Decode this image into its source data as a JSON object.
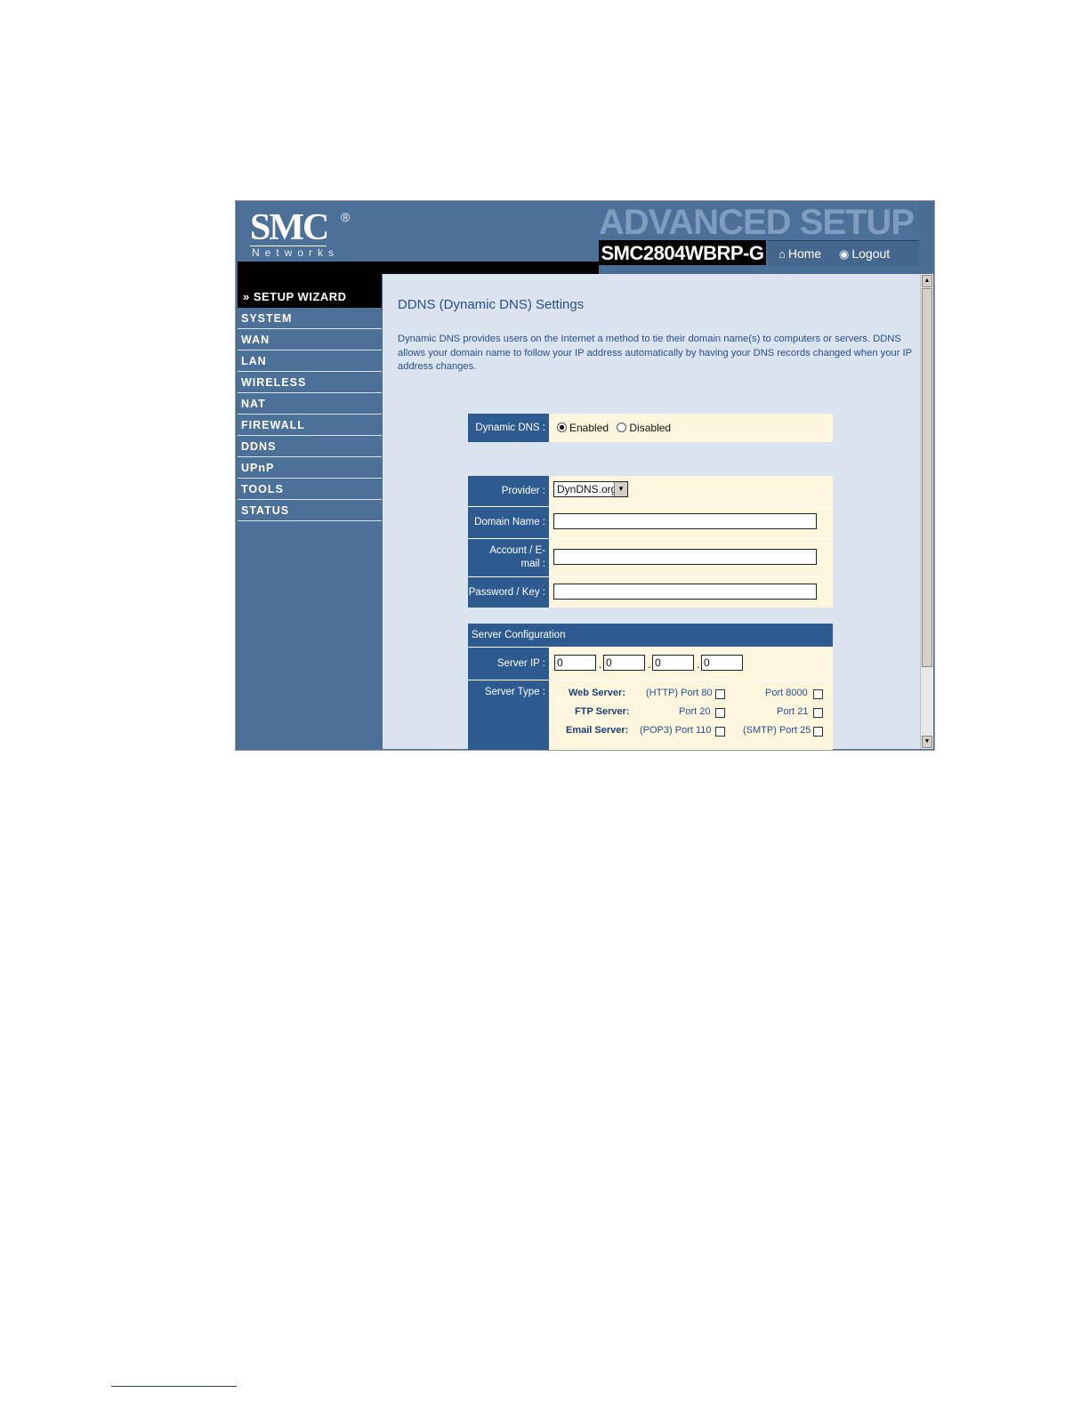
{
  "header": {
    "logo_text": "SMC",
    "logo_reg": "®",
    "logo_sub": "Networks",
    "banner": "ADVANCED SETUP",
    "model": "SMC2804WBRP-G",
    "home_label": "Home",
    "logout_label": "Logout"
  },
  "sidebar": {
    "wizard": "» SETUP WIZARD",
    "items": [
      "SYSTEM",
      "WAN",
      "LAN",
      "WIRELESS",
      "NAT",
      "FIREWALL",
      "DDNS",
      "UPnP",
      "TOOLS",
      "STATUS"
    ]
  },
  "content": {
    "title": "DDNS (Dynamic DNS) Settings",
    "description": "Dynamic DNS provides users on the Internet a method to tie their domain name(s) to computers or servers. DDNS allows your domain name to follow your IP address automatically by having your DNS records changed when your IP address changes."
  },
  "ddns": {
    "label": "Dynamic DNS :",
    "enabled": "Enabled",
    "disabled": "Disabled",
    "selected": "Enabled"
  },
  "form": {
    "provider_label": "Provider :",
    "provider_value": "DynDNS.org",
    "domain_label": "Domain Name :",
    "domain_value": "",
    "account_label_1": "Account / E-",
    "account_label_2": "mail :",
    "account_value": "",
    "password_label": "Password / Key :",
    "password_value": ""
  },
  "server": {
    "section_label": "Server Configuration",
    "ip_label": "Server IP :",
    "ip": [
      "0",
      "0",
      "0",
      "0"
    ],
    "type_label": "Server Type :",
    "types": [
      {
        "name": "Web Server:",
        "port_a": "(HTTP) Port 80",
        "port_b": "Port 8000"
      },
      {
        "name": "FTP Server:",
        "port_a": "Port 20",
        "port_b": "Port 21"
      },
      {
        "name": "Email Server:",
        "port_a": "(POP3) Port 110",
        "port_b": "(SMTP) Port 25"
      }
    ]
  }
}
